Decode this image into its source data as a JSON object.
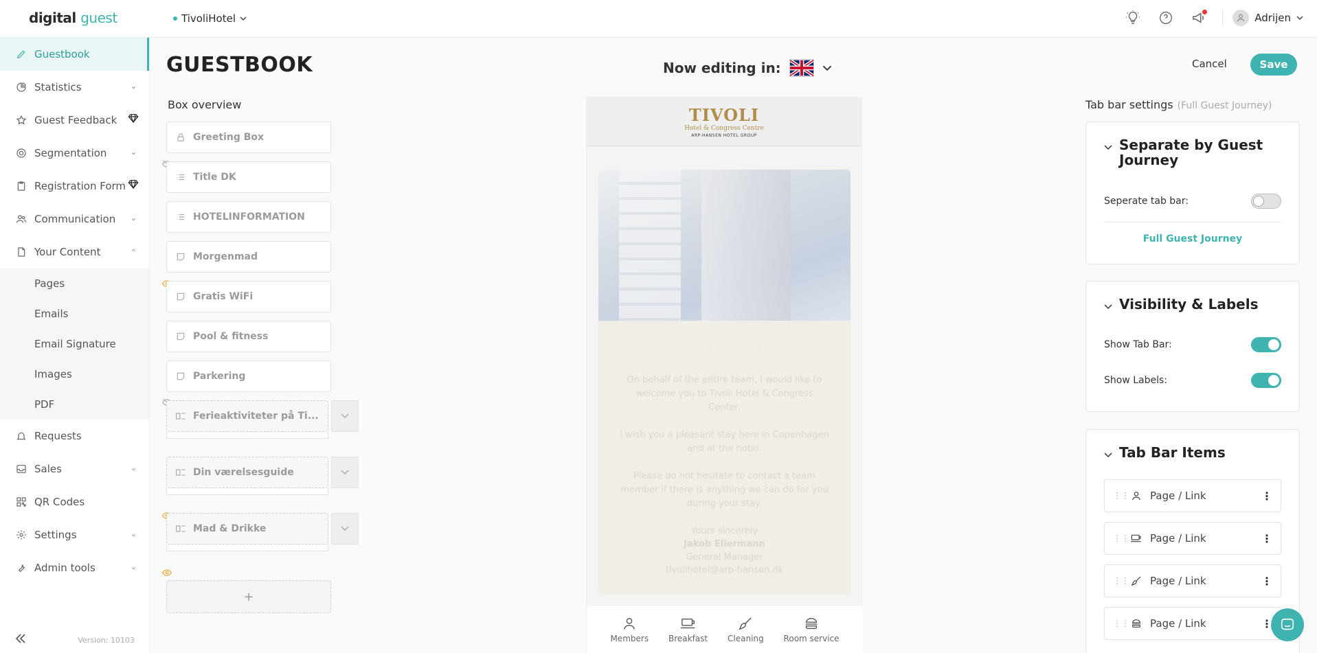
{
  "app": {
    "logo_part1": "digital",
    "logo_part2": "guest",
    "hotel": "TivoliHotel",
    "user": "Adrijen",
    "version": "Version: 10103"
  },
  "sidebar": {
    "items": [
      {
        "label": "Guestbook"
      },
      {
        "label": "Statistics"
      },
      {
        "label": "Guest Feedback"
      },
      {
        "label": "Segmentation"
      },
      {
        "label": "Registration Form"
      },
      {
        "label": "Communication"
      },
      {
        "label": "Your Content"
      }
    ],
    "sub_items": [
      {
        "label": "Pages"
      },
      {
        "label": "Emails"
      },
      {
        "label": "Email Signature"
      },
      {
        "label": "Images"
      },
      {
        "label": "PDF"
      }
    ],
    "bottom_items": [
      {
        "label": "Requests"
      },
      {
        "label": "Sales"
      },
      {
        "label": "QR Codes"
      },
      {
        "label": "Settings"
      },
      {
        "label": "Admin tools"
      }
    ]
  },
  "header": {
    "title": "GUESTBOOK",
    "editing_label": "Now editing in:",
    "cancel": "Cancel",
    "save": "Save"
  },
  "boxes": {
    "title": "Box overview",
    "items": [
      {
        "label": "Greeting Box"
      },
      {
        "label": "Title DK"
      },
      {
        "label": "HOTELINFORMATION"
      },
      {
        "label": "Morgenmad"
      },
      {
        "label": "Gratis WiFi"
      },
      {
        "label": "Pool & fitness"
      },
      {
        "label": "Parkering"
      },
      {
        "label": "Ferieaktiviteter på Ti..."
      },
      {
        "label": "Din værelsesguide"
      },
      {
        "label": "Mad & Drikke"
      }
    ],
    "add": "+"
  },
  "preview": {
    "brand_name": "TIVOLI",
    "brand_sub": "Hotel & Congress Centre",
    "brand_group": "ARP-HANSEN HOTEL GROUP",
    "welcome": "Welcome!",
    "p1": "On behalf of the entire team, I would like to welcome you to Tivoli Hotel & Congress Center.",
    "p2": "I wish you a pleasant stay here in Copenhagen and at the hotel.",
    "p3": "Please do not hesitate to contact a team member if there is anything we can do for you during your stay.",
    "sig1": "Yours sincerely",
    "sig2": "Jakob Ellermann",
    "sig3": "General Manager",
    "sig4": "tivolihotel@arp-hansen.dk",
    "tabs": [
      {
        "label": "Members"
      },
      {
        "label": "Breakfast"
      },
      {
        "label": "Cleaning"
      },
      {
        "label": "Room service"
      }
    ]
  },
  "settings": {
    "title": "Tab bar settings",
    "subtitle": "(Full Guest Journey)",
    "sep_title": "Separate by Guest Journey",
    "sep_label": "Seperate tab bar:",
    "sep_on": false,
    "journey_link": "Full Guest Journey",
    "vis_title": "Visibility & Labels",
    "show_tab_bar": "Show Tab Bar:",
    "show_labels": "Show Labels:",
    "items_title": "Tab Bar Items",
    "items": [
      {
        "label": "Page / Link",
        "icon": "user-icon"
      },
      {
        "label": "Page / Link",
        "icon": "coffee-icon"
      },
      {
        "label": "Page / Link",
        "icon": "brush-icon"
      },
      {
        "label": "Page / Link",
        "icon": "burger-icon"
      }
    ]
  },
  "colors": {
    "accent": "#3fb3b0",
    "brand_gold": "#b08d4a"
  }
}
